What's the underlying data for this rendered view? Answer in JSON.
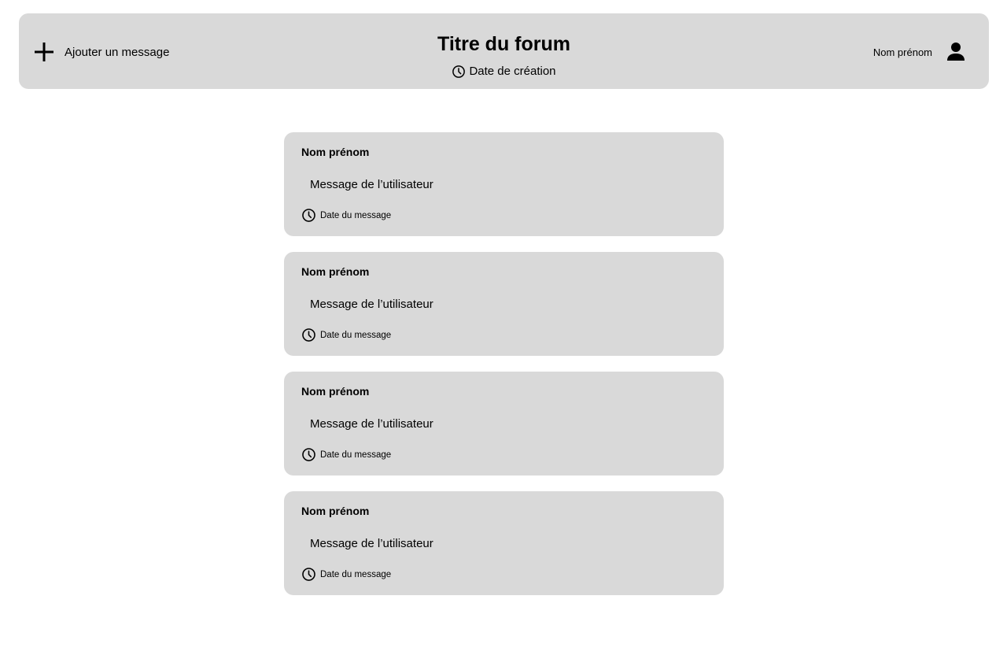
{
  "header": {
    "add_label": "Ajouter un message",
    "title": "Titre du forum",
    "creation_date": "Date de création",
    "user_name": "Nom prénom"
  },
  "icons": {
    "add": "plus-icon",
    "date": "clock-icon",
    "user": "user-icon"
  },
  "messages": [
    {
      "author": "Nom prénom",
      "text": "Message de l’utilisateur",
      "date": "Date du message"
    },
    {
      "author": "Nom prénom",
      "text": "Message de l’utilisateur",
      "date": "Date du message"
    },
    {
      "author": "Nom prénom",
      "text": "Message de l’utilisateur",
      "date": "Date du message"
    },
    {
      "author": "Nom prénom",
      "text": "Message de l’utilisateur",
      "date": "Date du message"
    }
  ],
  "colors": {
    "panel": "#d9d9d9",
    "background": "#ffffff",
    "text": "#000000"
  }
}
